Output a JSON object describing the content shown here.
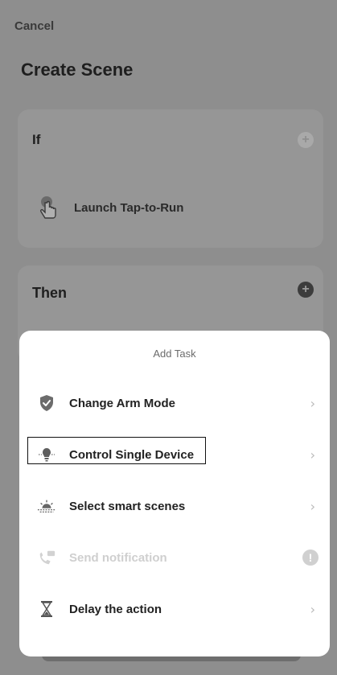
{
  "header": {
    "cancel_label": "Cancel",
    "title": "Create Scene"
  },
  "if_card": {
    "title": "If",
    "add_icon": "plus-circle-icon",
    "condition": {
      "icon": "tap-hand-icon",
      "label": "Launch Tap-to-Run"
    }
  },
  "then_card": {
    "title": "Then",
    "add_icon": "plus-circle-icon"
  },
  "add_task_sheet": {
    "title": "Add Task",
    "items": [
      {
        "icon": "shield-icon",
        "label": "Change Arm Mode",
        "enabled": true,
        "trailing": "chevron-right-icon"
      },
      {
        "icon": "bulb-icon",
        "label": "Control Single Device",
        "enabled": true,
        "highlighted": true,
        "trailing": "chevron-right-icon"
      },
      {
        "icon": "sunrise-icon",
        "label": "Select smart scenes",
        "enabled": true,
        "trailing": "chevron-right-icon"
      },
      {
        "icon": "phone-message-icon",
        "label": "Send notification",
        "enabled": false,
        "trailing": "info-icon"
      },
      {
        "icon": "hourglass-icon",
        "label": "Delay the action",
        "enabled": true,
        "trailing": "chevron-right-icon"
      }
    ],
    "info_badge_text": "!",
    "chevron_text": "›"
  },
  "colors": {
    "overlay_background": "#8e8e8e",
    "sheet_background": "#ffffff",
    "disabled_text": "#cfcfcf"
  }
}
